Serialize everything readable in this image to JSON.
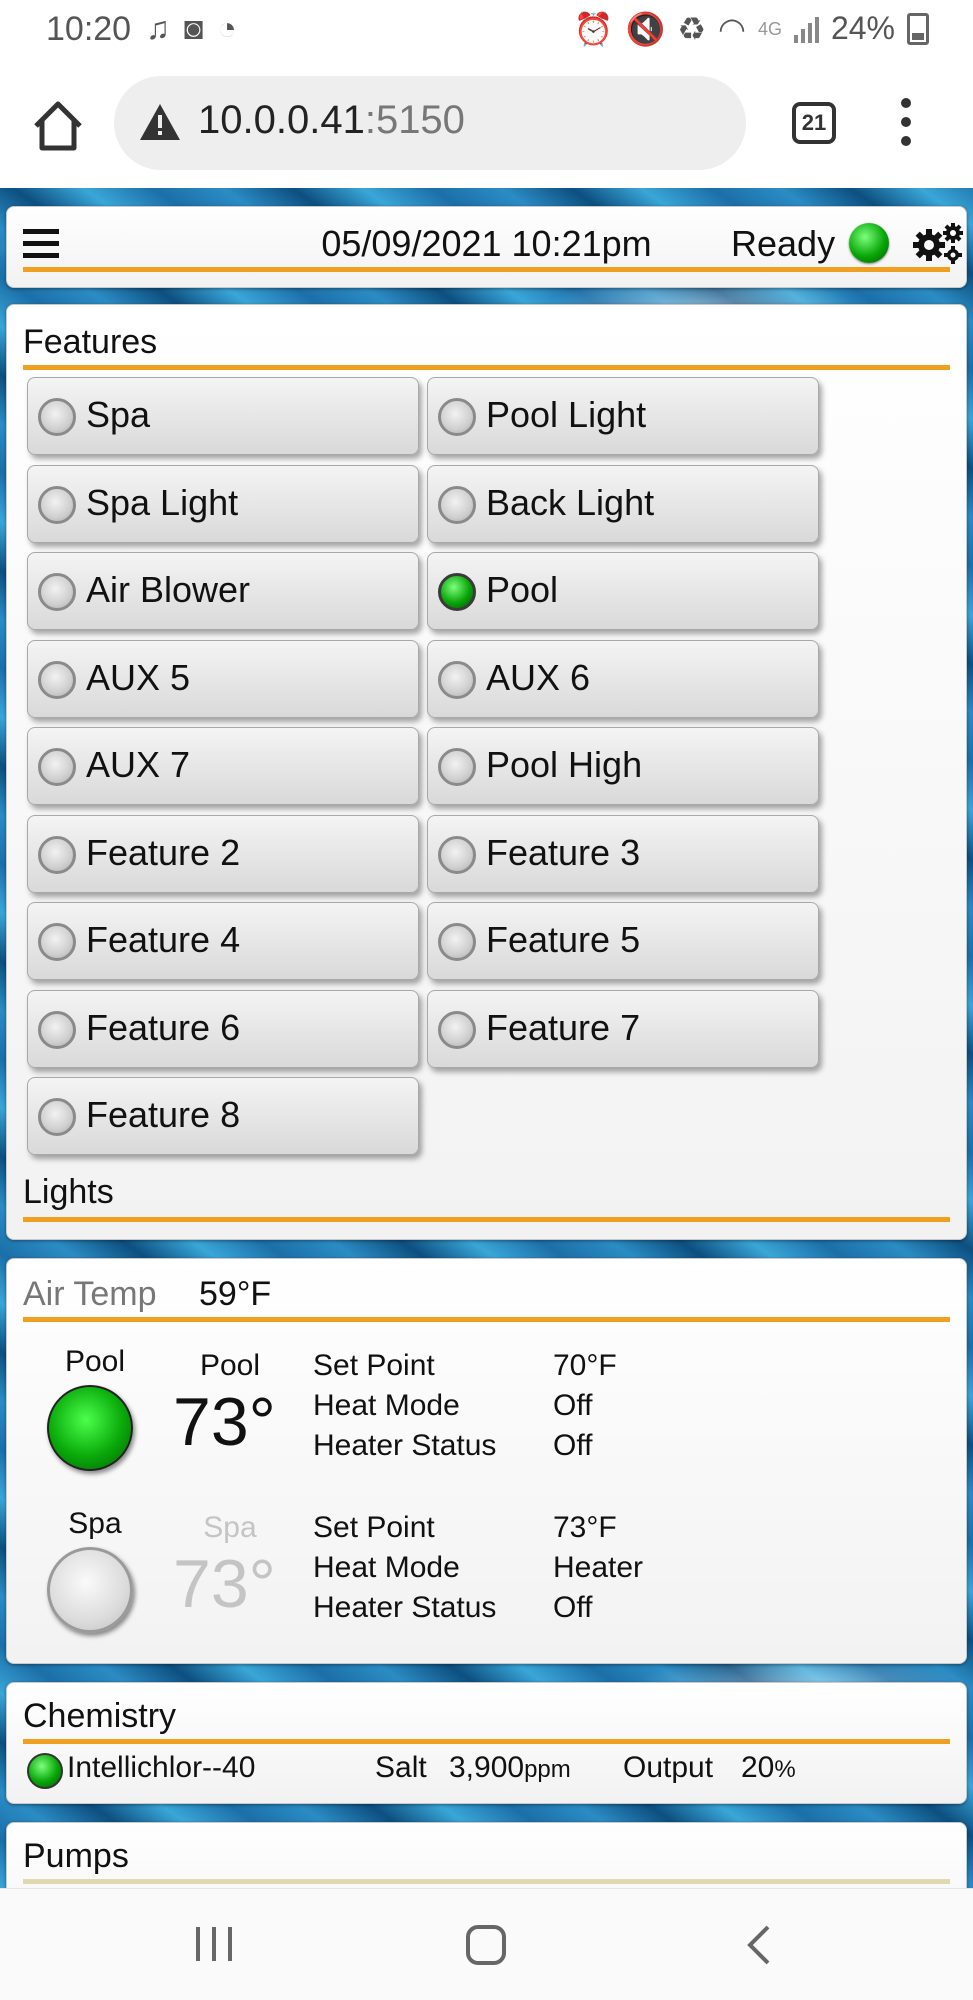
{
  "status_bar": {
    "time": "10:20",
    "battery": "24%",
    "network": "4G"
  },
  "browser": {
    "url_host": "10.0.0.41",
    "url_port": ":5150",
    "tab_count": "21"
  },
  "header": {
    "datetime": "05/09/2021 10:21pm",
    "status": "Ready"
  },
  "features": {
    "title": "Features",
    "items": [
      {
        "label": "Spa",
        "on": false
      },
      {
        "label": "Pool Light",
        "on": false
      },
      {
        "label": "Spa Light",
        "on": false
      },
      {
        "label": "Back Light",
        "on": false
      },
      {
        "label": "Air Blower",
        "on": false
      },
      {
        "label": "Pool",
        "on": true
      },
      {
        "label": "AUX 5",
        "on": false
      },
      {
        "label": "AUX 6",
        "on": false
      },
      {
        "label": "AUX 7",
        "on": false
      },
      {
        "label": "Pool High",
        "on": false
      },
      {
        "label": "Feature 2",
        "on": false
      },
      {
        "label": "Feature 3",
        "on": false
      },
      {
        "label": "Feature 4",
        "on": false
      },
      {
        "label": "Feature 5",
        "on": false
      },
      {
        "label": "Feature 6",
        "on": false
      },
      {
        "label": "Feature 7",
        "on": false
      },
      {
        "label": "Feature 8",
        "on": false
      }
    ],
    "lights_title": "Lights"
  },
  "temps": {
    "air_label": "Air Temp",
    "air_value": "59°F",
    "bodies": [
      {
        "name": "Pool",
        "caption": "Pool",
        "temp": "73°",
        "on": true,
        "rows": [
          {
            "label": "Set Point",
            "value": "70°F"
          },
          {
            "label": "Heat Mode",
            "value": "Off"
          },
          {
            "label": "Heater Status",
            "value": "Off"
          }
        ]
      },
      {
        "name": "Spa",
        "caption": "Spa",
        "temp": "73°",
        "on": false,
        "rows": [
          {
            "label": "Set Point",
            "value": "73°F"
          },
          {
            "label": "Heat Mode",
            "value": "Heater"
          },
          {
            "label": "Heater Status",
            "value": "Off"
          }
        ]
      }
    ]
  },
  "chemistry": {
    "title": "Chemistry",
    "device": "Intellichlor--40",
    "salt_label": "Salt",
    "salt_value": "3,900",
    "salt_unit": "ppm",
    "output_label": "Output",
    "output_value": "20",
    "output_unit": "%"
  },
  "pumps": {
    "title": "Pumps"
  },
  "colors": {
    "accent": "#f0a020",
    "led_on": "#0aa50a",
    "led_off": "#cfcfcf"
  }
}
